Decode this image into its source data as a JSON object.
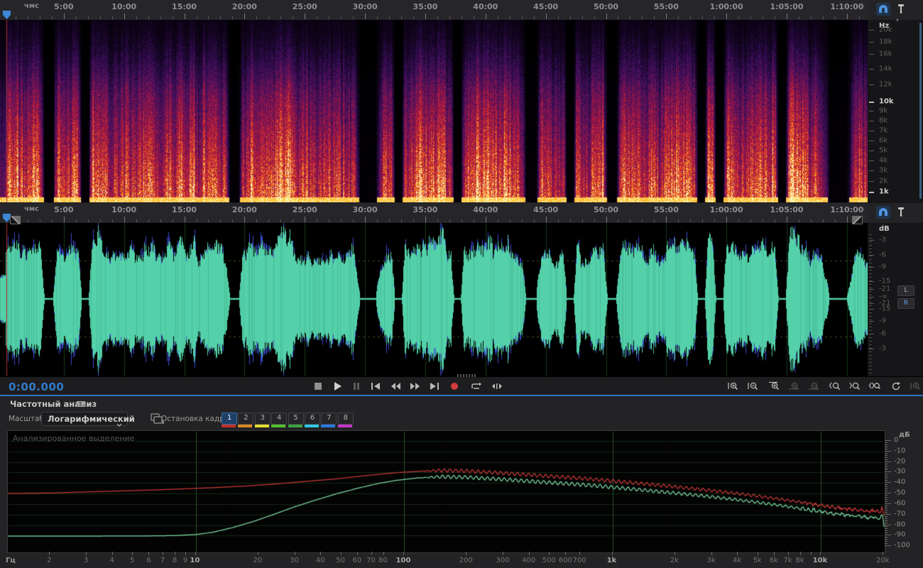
{
  "colors": {
    "accent_blue": "#3d87d8",
    "time_display_blue": "#3579c8",
    "curve_red": "#c93a3a",
    "curve_green": "#7fd9a6",
    "waveform_teal": "#54d1a9",
    "waveform_blue": "#3b49cf",
    "record_red": "#d23b3b"
  },
  "timeline": {
    "unit_label": "чмс",
    "major_ticks": [
      {
        "min": 5,
        "label": "5:00"
      },
      {
        "min": 10,
        "label": "10:00"
      },
      {
        "min": 15,
        "label": "15:00"
      },
      {
        "min": 20,
        "label": "20:00"
      },
      {
        "min": 25,
        "label": "25:00"
      },
      {
        "min": 30,
        "label": "30:00"
      },
      {
        "min": 35,
        "label": "35:00"
      },
      {
        "min": 40,
        "label": "40:00"
      },
      {
        "min": 45,
        "label": "45:00"
      },
      {
        "min": 50,
        "label": "50:00"
      },
      {
        "min": 55,
        "label": "55:00"
      },
      {
        "min": 60,
        "label": "1:00:00"
      },
      {
        "min": 65,
        "label": "1:05:00"
      },
      {
        "min": 70,
        "label": "1:10:00"
      }
    ]
  },
  "spectrogram": {
    "scale_unit": "Hz",
    "scale_labels": [
      {
        "text": "20k",
        "y": 42
      },
      {
        "text": "18k",
        "y": 59
      },
      {
        "text": "16k",
        "y": 76
      },
      {
        "text": "14k",
        "y": 97
      },
      {
        "text": "12k",
        "y": 119
      },
      {
        "text": "10k",
        "y": 143,
        "bold": true
      },
      {
        "text": "9k",
        "y": 156
      },
      {
        "text": "8k",
        "y": 170
      },
      {
        "text": "7k",
        "y": 184
      },
      {
        "text": "6k",
        "y": 198
      },
      {
        "text": "5k",
        "y": 212
      },
      {
        "text": "4k",
        "y": 226
      },
      {
        "text": "3k",
        "y": 240
      },
      {
        "text": "2k",
        "y": 255
      },
      {
        "text": "1k",
        "y": 270,
        "bold": true
      }
    ]
  },
  "audio": {
    "seed": 1337,
    "gaps": [
      {
        "c": 0.056,
        "w": 0.005
      },
      {
        "c": 0.098,
        "w": 0.004
      },
      {
        "c": 0.27,
        "w": 0.005
      },
      {
        "c": 0.424,
        "w": 0.009
      },
      {
        "c": 0.459,
        "w": 0.004
      },
      {
        "c": 0.527,
        "w": 0.004
      },
      {
        "c": 0.612,
        "w": 0.006
      },
      {
        "c": 0.657,
        "w": 0.004
      },
      {
        "c": 0.705,
        "w": 0.005
      },
      {
        "c": 0.808,
        "w": 0.004
      },
      {
        "c": 0.829,
        "w": 0.004
      },
      {
        "c": 0.901,
        "w": 0.004
      },
      {
        "c": 0.966,
        "w": 0.01
      }
    ]
  },
  "waveform": {
    "db_unit": "dB",
    "db_labels": [
      {
        "text": "-3",
        "y": 338
      },
      {
        "text": "-6",
        "y": 359
      },
      {
        "text": "-9",
        "y": 376
      },
      {
        "text": "-15",
        "y": 396
      },
      {
        "text": "-21",
        "y": 407
      },
      {
        "text": "-∞",
        "y": 418
      },
      {
        "text": "-21",
        "y": 427
      },
      {
        "text": "-15",
        "y": 435
      },
      {
        "text": "-9",
        "y": 452
      },
      {
        "text": "-6",
        "y": 470
      },
      {
        "text": "-3",
        "y": 491
      }
    ],
    "channel_buttons": [
      {
        "label": "L"
      },
      {
        "label": "R",
        "blue": true
      }
    ]
  },
  "transport": {
    "time_display": "0:00.000",
    "buttons": [
      {
        "name": "stop"
      },
      {
        "name": "play"
      },
      {
        "name": "pause",
        "dim": true
      },
      {
        "name": "skip-to-start"
      },
      {
        "name": "rewind"
      },
      {
        "name": "fast-forward"
      },
      {
        "name": "skip-to-end"
      },
      {
        "name": "record"
      },
      {
        "name": "loop-playback"
      },
      {
        "name": "skip-selection"
      }
    ]
  },
  "zoom_tools": [
    {
      "name": "zoom-in-horizontal"
    },
    {
      "name": "zoom-out-horizontal"
    },
    {
      "name": "zoom-to-selection"
    },
    {
      "name": "zoom-in-vertical",
      "dim": true
    },
    {
      "name": "zoom-out-vertical",
      "dim": true
    },
    {
      "name": "zoom-selection-left"
    },
    {
      "name": "zoom-selection-right"
    },
    {
      "name": "zoom-selection-both"
    },
    {
      "name": "reset-zoom"
    },
    {
      "name": "zoom-full",
      "dim": true
    }
  ],
  "analysis": {
    "panel_title": "Частотный анализ",
    "scale_label": "Масштаб:",
    "scale_value": "Логарифмический",
    "hold_label": "Остановка кадра:",
    "hold_buttons": [
      {
        "n": "1",
        "color": "#c23028",
        "active": true
      },
      {
        "n": "2",
        "color": "#dd8820"
      },
      {
        "n": "3",
        "color": "#e5dd32"
      },
      {
        "n": "4",
        "color": "#52c032"
      },
      {
        "n": "5",
        "color": "#3da23d"
      },
      {
        "n": "6",
        "color": "#31c6e6"
      },
      {
        "n": "7",
        "color": "#2a7ade"
      },
      {
        "n": "8",
        "color": "#c438c8"
      }
    ],
    "overlay_text": "Анализированное выделение"
  },
  "chart_data": {
    "type": "line",
    "title": "Частотный анализ",
    "xlabel": "Гц",
    "ylabel": "дБ",
    "x_scale": "log",
    "x_range_hz": [
      1.2,
      20500
    ],
    "y_range_db": [
      -100,
      0
    ],
    "grid": true,
    "legend": "none",
    "x_ticks": [
      {
        "f": 2,
        "label": "2"
      },
      {
        "f": 3,
        "label": "3"
      },
      {
        "f": 4,
        "label": "4"
      },
      {
        "f": 5,
        "label": "5"
      },
      {
        "f": 6,
        "label": "6"
      },
      {
        "f": 7,
        "label": "7"
      },
      {
        "f": 8,
        "label": "8"
      },
      {
        "f": 9,
        "label": "9"
      },
      {
        "f": 10,
        "label": "10",
        "bold": true
      },
      {
        "f": 20,
        "label": "20"
      },
      {
        "f": 30,
        "label": "30"
      },
      {
        "f": 40,
        "label": "40"
      },
      {
        "f": 50,
        "label": "50"
      },
      {
        "f": 60,
        "label": "60"
      },
      {
        "f": 70,
        "label": "70"
      },
      {
        "f": 80,
        "label": "80"
      },
      {
        "f": 100,
        "label": "100",
        "bold": true
      },
      {
        "f": 200,
        "label": "200"
      },
      {
        "f": 300,
        "label": "300"
      },
      {
        "f": 400,
        "label": "400"
      },
      {
        "f": 500,
        "label": "500"
      },
      {
        "f": 600,
        "label": "600"
      },
      {
        "f": 700,
        "label": "700"
      },
      {
        "f": 1000,
        "label": "1k",
        "bold": true
      },
      {
        "f": 2000,
        "label": "2k"
      },
      {
        "f": 3000,
        "label": "3k"
      },
      {
        "f": 4000,
        "label": "4k"
      },
      {
        "f": 5000,
        "label": "5k"
      },
      {
        "f": 6000,
        "label": "6k"
      },
      {
        "f": 7000,
        "label": "7k"
      },
      {
        "f": 8000,
        "label": "8k"
      },
      {
        "f": 9000,
        "label": ""
      },
      {
        "f": 10000,
        "label": "10k",
        "bold": true
      },
      {
        "f": 20000,
        "label": "20k"
      }
    ],
    "y_ticks": [
      0,
      -10,
      -20,
      -30,
      -40,
      -50,
      -60,
      -70,
      -80,
      -90,
      -100
    ],
    "ripple": {
      "start_hz": 120,
      "wavelength_decades": 0.027,
      "amplitude_db": 1.6
    },
    "series": [
      {
        "name": "red",
        "color": "#c93a3a",
        "points": [
          [
            1.2,
            -50
          ],
          [
            2,
            -49.5
          ],
          [
            3,
            -48.5
          ],
          [
            4.5,
            -47.5
          ],
          [
            6.5,
            -46.5
          ],
          [
            9,
            -45.5
          ],
          [
            12,
            -44.5
          ],
          [
            17,
            -43
          ],
          [
            24,
            -41
          ],
          [
            34,
            -38.5
          ],
          [
            48,
            -36
          ],
          [
            62,
            -33.5
          ],
          [
            78,
            -31.5
          ],
          [
            95,
            -30
          ],
          [
            120,
            -28.8
          ],
          [
            155,
            -28
          ],
          [
            200,
            -28.6
          ],
          [
            270,
            -30
          ],
          [
            370,
            -31.8
          ],
          [
            500,
            -33.6
          ],
          [
            650,
            -35
          ],
          [
            850,
            -36.8
          ],
          [
            1100,
            -38.8
          ],
          [
            1500,
            -41.2
          ],
          [
            2000,
            -43.6
          ],
          [
            2700,
            -46.2
          ],
          [
            3600,
            -49
          ],
          [
            4800,
            -52
          ],
          [
            6400,
            -55.4
          ],
          [
            8500,
            -59
          ],
          [
            10000,
            -61
          ],
          [
            12000,
            -63.5
          ],
          [
            14500,
            -65.5
          ],
          [
            17000,
            -67
          ],
          [
            18500,
            -66
          ],
          [
            19300,
            -68.5
          ],
          [
            19700,
            -62.5
          ],
          [
            20000,
            -69
          ],
          [
            20200,
            -76
          ],
          [
            20400,
            -90
          ]
        ]
      },
      {
        "name": "green",
        "color": "#7fd9a6",
        "points": [
          [
            1.2,
            -90.5
          ],
          [
            3,
            -90.5
          ],
          [
            6,
            -90.3
          ],
          [
            8,
            -90
          ],
          [
            10,
            -89
          ],
          [
            12,
            -87
          ],
          [
            15,
            -82.5
          ],
          [
            19,
            -76.5
          ],
          [
            24,
            -69.5
          ],
          [
            30,
            -62.5
          ],
          [
            38,
            -56
          ],
          [
            48,
            -50
          ],
          [
            60,
            -45
          ],
          [
            75,
            -40.5
          ],
          [
            92,
            -37.5
          ],
          [
            115,
            -35.3
          ],
          [
            150,
            -34
          ],
          [
            200,
            -34.6
          ],
          [
            270,
            -36
          ],
          [
            370,
            -37.8
          ],
          [
            500,
            -39.6
          ],
          [
            650,
            -41
          ],
          [
            850,
            -42.8
          ],
          [
            1100,
            -44.8
          ],
          [
            1500,
            -47.2
          ],
          [
            2000,
            -49.6
          ],
          [
            2700,
            -52.2
          ],
          [
            3600,
            -55
          ],
          [
            4800,
            -58
          ],
          [
            6400,
            -61.4
          ],
          [
            8500,
            -65
          ],
          [
            10000,
            -67
          ],
          [
            12000,
            -69.5
          ],
          [
            14500,
            -71.5
          ],
          [
            17000,
            -73
          ],
          [
            18500,
            -72.5
          ],
          [
            19300,
            -74.5
          ],
          [
            19700,
            -69.5
          ],
          [
            20000,
            -76
          ],
          [
            20200,
            -85
          ],
          [
            20400,
            -99
          ]
        ]
      }
    ]
  }
}
